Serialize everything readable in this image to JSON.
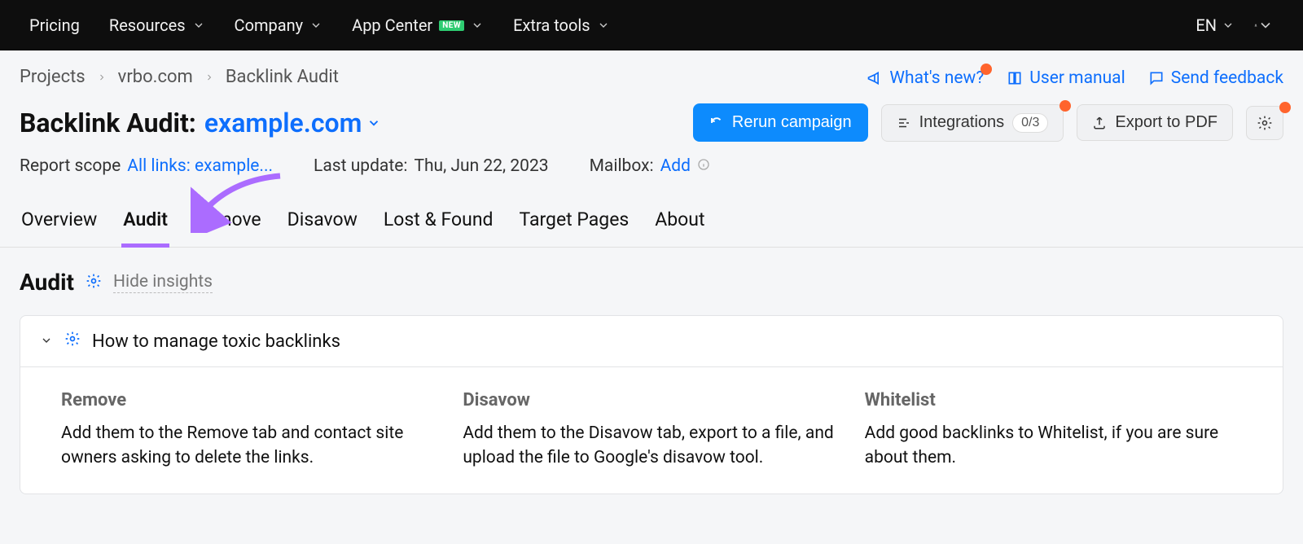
{
  "topnav": {
    "items": [
      "Pricing",
      "Resources",
      "Company",
      "App Center",
      "Extra tools"
    ],
    "new_badge": "new",
    "lang": "EN"
  },
  "breadcrumb": [
    "Projects",
    "vrbo.com",
    "Backlink Audit"
  ],
  "header_links": {
    "whats_new": "What's new?",
    "user_manual": "User manual",
    "send_feedback": "Send feedback"
  },
  "title": {
    "prefix": "Backlink Audit:",
    "domain": "example.com"
  },
  "actions": {
    "rerun": "Rerun campaign",
    "integrations": "Integrations",
    "integrations_count": "0/3",
    "export": "Export to PDF"
  },
  "info": {
    "report_scope_label": "Report scope",
    "report_scope_value": "All links: example...",
    "last_update_label": "Last update:",
    "last_update_value": "Thu, Jun 22, 2023",
    "mailbox_label": "Mailbox:",
    "mailbox_value": "Add"
  },
  "tabs": [
    "Overview",
    "Audit",
    "Remove",
    "Disavow",
    "Lost & Found",
    "Target Pages",
    "About"
  ],
  "active_tab": "Audit",
  "section": {
    "title": "Audit",
    "hide_insights": "Hide insights"
  },
  "insights_card": {
    "header": "How to manage toxic backlinks",
    "columns": [
      {
        "title": "Remove",
        "body": "Add them to the Remove tab and contact site owners asking to delete the links."
      },
      {
        "title": "Disavow",
        "body": "Add them to the Disavow tab, export to a file, and upload the file to Google's disavow tool."
      },
      {
        "title": "Whitelist",
        "body": "Add good backlinks to Whitelist, if you are sure about them."
      }
    ]
  }
}
